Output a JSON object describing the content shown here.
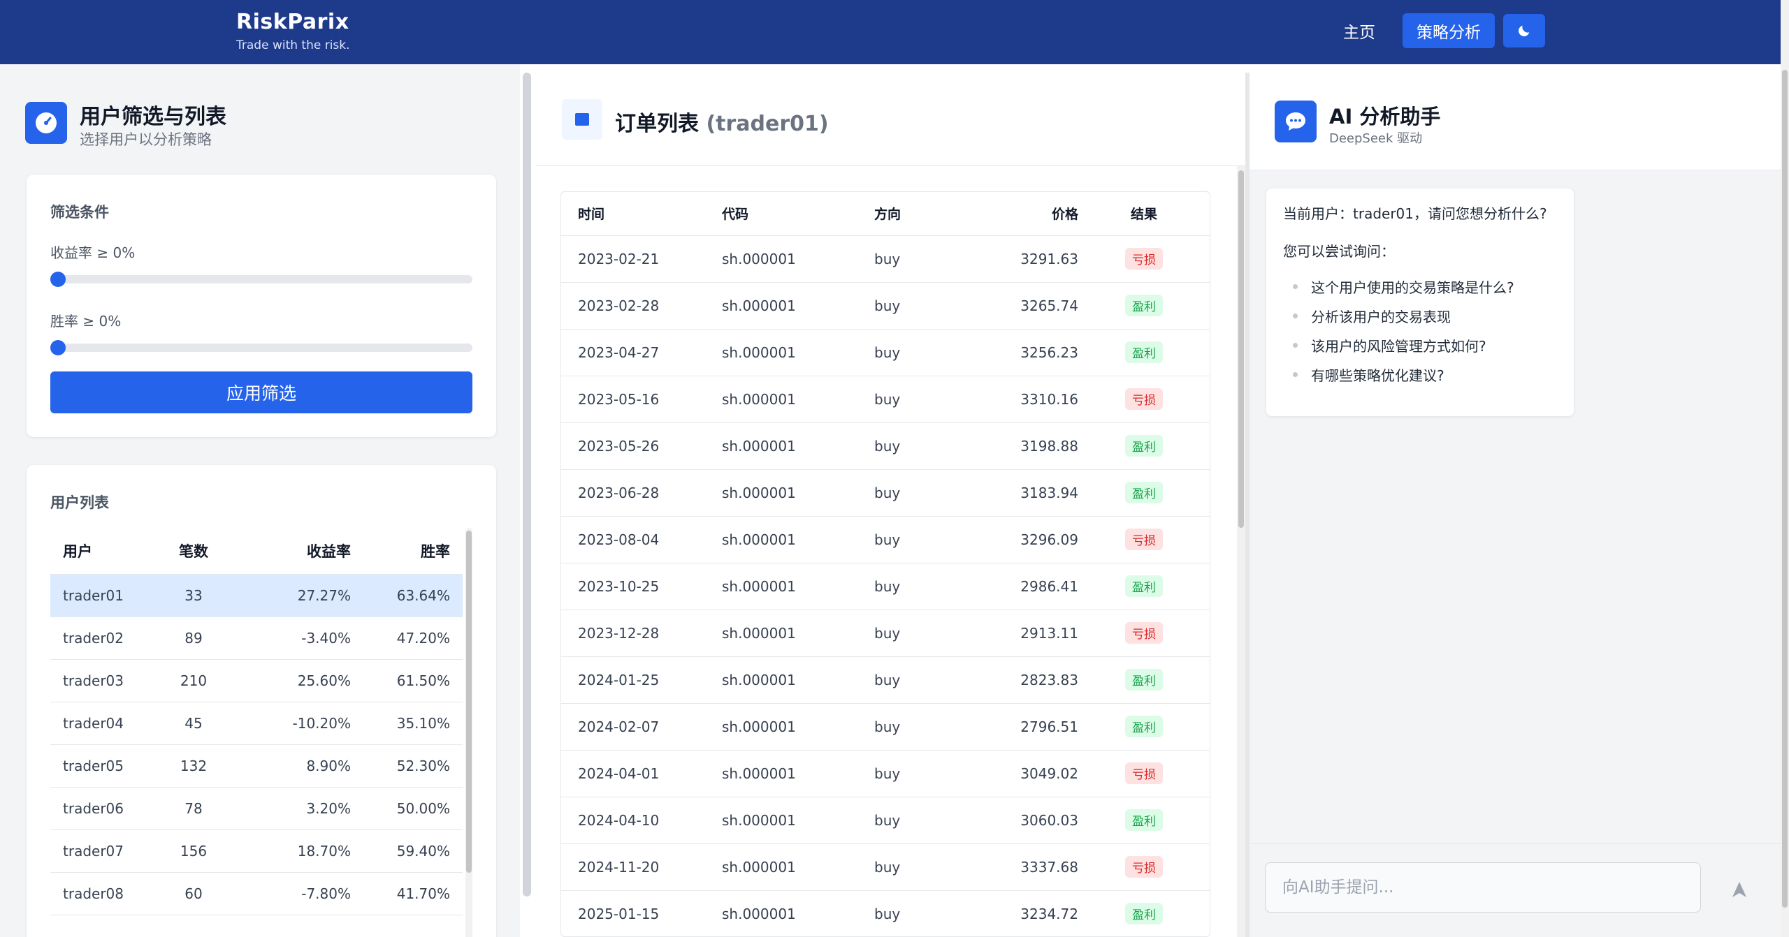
{
  "header": {
    "brand": "RiskParix",
    "tagline": "Trade with the risk.",
    "nav_home": "主页",
    "nav_strategy": "策略分析",
    "theme_icon": "moon-icon"
  },
  "left": {
    "title": "用户筛选与列表",
    "subtitle": "选择用户以分析策略",
    "filter": {
      "title": "筛选条件",
      "return_label": "收益率 ≥ 0%",
      "return_value": 0,
      "winrate_label": "胜率 ≥ 0%",
      "winrate_value": 0,
      "apply_label": "应用筛选"
    },
    "users": {
      "title": "用户列表",
      "columns": [
        "用户",
        "笔数",
        "收益率",
        "胜率"
      ],
      "rows": [
        {
          "user": "trader01",
          "count": "33",
          "return": "27.27%",
          "winrate": "63.64%"
        },
        {
          "user": "trader02",
          "count": "89",
          "return": "-3.40%",
          "winrate": "47.20%"
        },
        {
          "user": "trader03",
          "count": "210",
          "return": "25.60%",
          "winrate": "61.50%"
        },
        {
          "user": "trader04",
          "count": "45",
          "return": "-10.20%",
          "winrate": "35.10%"
        },
        {
          "user": "trader05",
          "count": "132",
          "return": "8.90%",
          "winrate": "52.30%"
        },
        {
          "user": "trader06",
          "count": "78",
          "return": "3.20%",
          "winrate": "50.00%"
        },
        {
          "user": "trader07",
          "count": "156",
          "return": "18.70%",
          "winrate": "59.40%"
        },
        {
          "user": "trader08",
          "count": "60",
          "return": "-7.80%",
          "winrate": "41.70%"
        }
      ]
    }
  },
  "orders": {
    "title": "订单列表",
    "user": "(trader01)",
    "columns": [
      "时间",
      "代码",
      "方向",
      "价格",
      "结果"
    ],
    "rows": [
      {
        "time": "2023-02-21",
        "code": "sh.000001",
        "dir": "buy",
        "price": "3291.63",
        "result": "亏损"
      },
      {
        "time": "2023-02-28",
        "code": "sh.000001",
        "dir": "buy",
        "price": "3265.74",
        "result": "盈利"
      },
      {
        "time": "2023-04-27",
        "code": "sh.000001",
        "dir": "buy",
        "price": "3256.23",
        "result": "盈利"
      },
      {
        "time": "2023-05-16",
        "code": "sh.000001",
        "dir": "buy",
        "price": "3310.16",
        "result": "亏损"
      },
      {
        "time": "2023-05-26",
        "code": "sh.000001",
        "dir": "buy",
        "price": "3198.88",
        "result": "盈利"
      },
      {
        "time": "2023-06-28",
        "code": "sh.000001",
        "dir": "buy",
        "price": "3183.94",
        "result": "盈利"
      },
      {
        "time": "2023-08-04",
        "code": "sh.000001",
        "dir": "buy",
        "price": "3296.09",
        "result": "亏损"
      },
      {
        "time": "2023-10-25",
        "code": "sh.000001",
        "dir": "buy",
        "price": "2986.41",
        "result": "盈利"
      },
      {
        "time": "2023-12-28",
        "code": "sh.000001",
        "dir": "buy",
        "price": "2913.11",
        "result": "亏损"
      },
      {
        "time": "2024-01-25",
        "code": "sh.000001",
        "dir": "buy",
        "price": "2823.83",
        "result": "盈利"
      },
      {
        "time": "2024-02-07",
        "code": "sh.000001",
        "dir": "buy",
        "price": "2796.51",
        "result": "盈利"
      },
      {
        "time": "2024-04-01",
        "code": "sh.000001",
        "dir": "buy",
        "price": "3049.02",
        "result": "亏损"
      },
      {
        "time": "2024-04-10",
        "code": "sh.000001",
        "dir": "buy",
        "price": "3060.03",
        "result": "盈利"
      },
      {
        "time": "2024-11-20",
        "code": "sh.000001",
        "dir": "buy",
        "price": "3337.68",
        "result": "亏损"
      },
      {
        "time": "2025-01-15",
        "code": "sh.000001",
        "dir": "buy",
        "price": "3234.72",
        "result": "盈利"
      }
    ]
  },
  "ai": {
    "title": "AI 分析助手",
    "subtitle": "DeepSeek 驱动",
    "greeting": "当前用户：trader01，请问您想分析什么?",
    "try_label": "您可以尝试询问：",
    "suggestions": [
      "这个用户使用的交易策略是什么?",
      "分析该用户的交易表现",
      "该用户的风险管理方式如何?",
      "有哪些策略优化建议?"
    ],
    "input_placeholder": "向AI助手提问...",
    "send_icon": "send-icon"
  },
  "colors": {
    "header_bg": "#1e3a8a",
    "accent": "#2563eb",
    "positive": "#16a34a",
    "negative": "#dc2626"
  }
}
